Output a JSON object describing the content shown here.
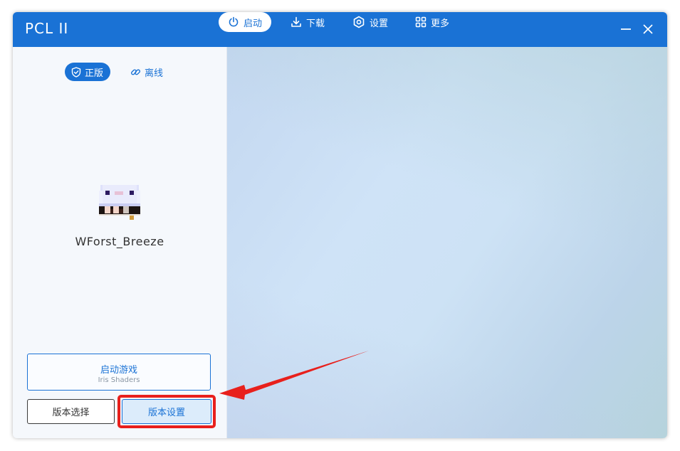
{
  "titlebar": {
    "app_title": "PCL II",
    "nav": [
      {
        "label": "启动",
        "icon": "power-icon",
        "active": true
      },
      {
        "label": "下载",
        "icon": "download-icon",
        "active": false
      },
      {
        "label": "设置",
        "icon": "settings-icon",
        "active": false
      },
      {
        "label": "更多",
        "icon": "grid-icon",
        "active": false
      }
    ],
    "controls": [
      "minimize-icon",
      "close-icon"
    ]
  },
  "sidebar": {
    "mode_tabs": [
      {
        "label": "正版",
        "icon": "shield-check-icon",
        "active": true
      },
      {
        "label": "离线",
        "icon": "link-icon",
        "active": false
      }
    ],
    "username": "WForst_Breeze",
    "launch_button": {
      "label": "启动游戏",
      "subtitle": "Iris Shaders"
    },
    "version_select_label": "版本选择",
    "version_settings_label": "版本设置"
  },
  "colors": {
    "accent": "#1a72d5",
    "highlight": "#e8201c"
  }
}
